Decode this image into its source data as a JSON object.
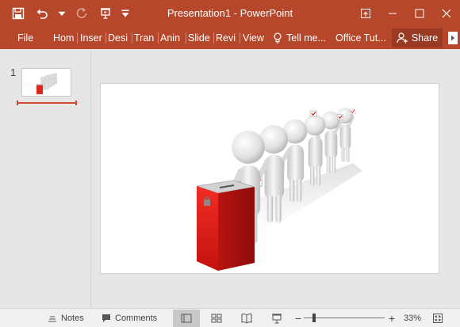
{
  "app": {
    "title": "Presentation1 - PowerPoint"
  },
  "colors": {
    "accent": "#b7472a",
    "share_bg": "#9a3a22",
    "statusbar": "#f0f0f0",
    "ballot_box": "#e0251f"
  },
  "quick_access": [
    {
      "icon": "save-icon"
    },
    {
      "icon": "undo-icon"
    },
    {
      "icon": "redo-icon"
    },
    {
      "icon": "present-from-beginning-icon"
    },
    {
      "icon": "customize-toolbar-icon"
    }
  ],
  "window_controls": [
    {
      "icon": "ribbon-display-options-icon"
    },
    {
      "icon": "minimize-icon"
    },
    {
      "icon": "maximize-icon"
    },
    {
      "icon": "close-icon"
    }
  ],
  "ribbon": {
    "tabs": [
      "File",
      "Hom",
      "Inser",
      "Desi",
      "Tran",
      "Anin",
      "Slide",
      "Revi",
      "View"
    ],
    "tell_me": "Tell me...",
    "office_tut": "Office Tut...",
    "share": "Share"
  },
  "thumbnails": [
    {
      "number": "1"
    }
  ],
  "slide": {
    "image": "stick figures in line casting votes into a red ballot box"
  },
  "statusbar": {
    "notes": "Notes",
    "comments": "Comments",
    "views": [
      "normal-view-icon",
      "slide-sorter-icon",
      "reading-view-icon",
      "slide-show-icon"
    ],
    "active_view": "normal-view-icon",
    "zoom_minus": "−",
    "zoom_plus": "+",
    "zoom_percent": "33%",
    "zoom_level": 0.33
  }
}
